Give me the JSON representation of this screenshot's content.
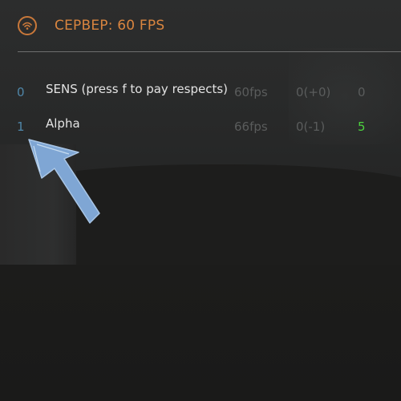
{
  "header": {
    "icon": "wifi-icon",
    "server_label": "СЕРВЕР: 60 FPS",
    "accent_color": "#d9853f"
  },
  "players": [
    {
      "index": "0",
      "name": "SENS (press f to pay respects)",
      "fps": "60fps",
      "delta": "0(+0)",
      "score": "0"
    },
    {
      "index": "1",
      "name": "Alpha",
      "fps": "66fps",
      "delta": "0(-1)",
      "score": "5",
      "score_color": "#4cd23e"
    }
  ],
  "annotation": {
    "icon": "arrow-pointer-icon",
    "color": "#7fa6d4"
  }
}
